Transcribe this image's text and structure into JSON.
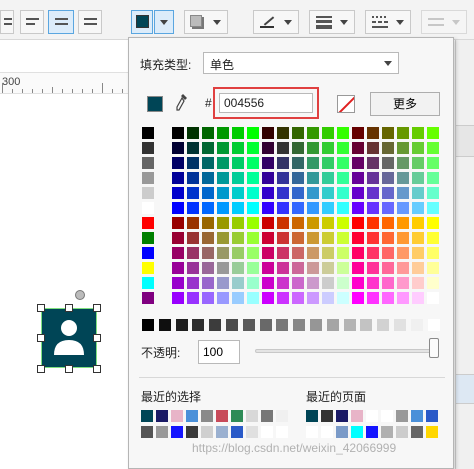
{
  "ruler": {
    "label": "300"
  },
  "popup": {
    "fill_type_label": "填充类型:",
    "fill_type_value": "单色",
    "hash_label": "#",
    "hex_value": "004556",
    "more_button": "更多",
    "opacity_label": "不透明:",
    "opacity_value": "100",
    "opacity_fraction": 1.0,
    "recent_selection_label": "最近的选择",
    "recent_page_label": "最近的页面",
    "current_color": "#004556"
  },
  "watermark": "https://blog.csdn.net/weixin_42066999",
  "icons": [
    "align-left-icon",
    "align-center-icon",
    "align-right-icon",
    "fill-color-icon",
    "shadow-icon",
    "line-color-icon",
    "line-weight-icon",
    "line-style-icon",
    "arrow-style-icon",
    "eyedropper-icon",
    "no-fill-icon",
    "user-icon"
  ]
}
